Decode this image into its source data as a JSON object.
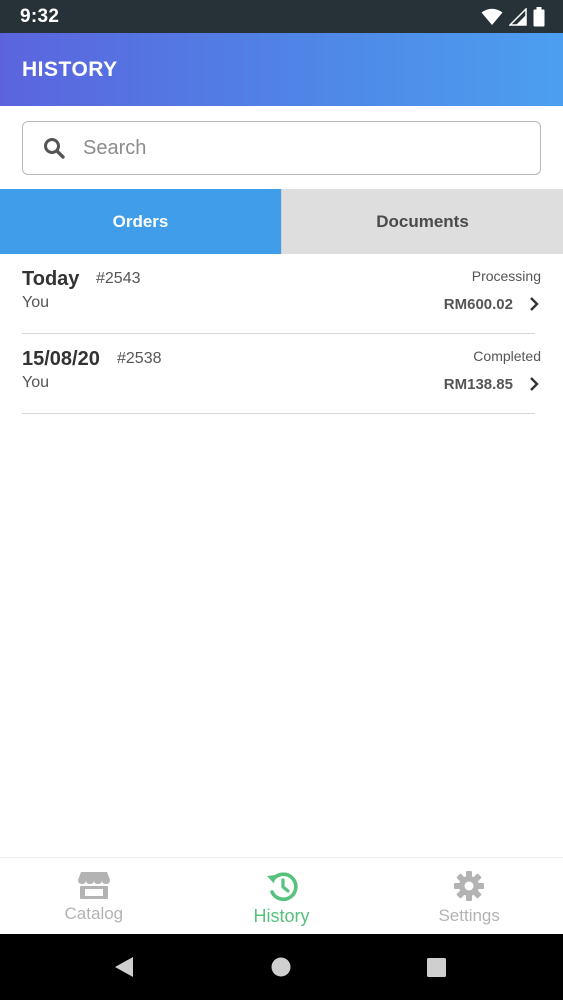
{
  "status_bar": {
    "time": "9:32"
  },
  "header": {
    "title": "HISTORY"
  },
  "search": {
    "placeholder": "Search",
    "value": ""
  },
  "tabs": [
    {
      "label": "Orders",
      "active": true
    },
    {
      "label": "Documents",
      "active": false
    }
  ],
  "orders": [
    {
      "date": "Today",
      "number": "#2543",
      "user": "You",
      "status": "Processing",
      "amount": "RM600.02"
    },
    {
      "date": "15/08/20",
      "number": "#2538",
      "user": "You",
      "status": "Completed",
      "amount": "RM138.85"
    }
  ],
  "bottom_nav": [
    {
      "label": "Catalog",
      "icon": "store-icon",
      "active": false
    },
    {
      "label": "History",
      "icon": "history-icon",
      "active": true
    },
    {
      "label": "Settings",
      "icon": "gear-icon",
      "active": false
    }
  ],
  "colors": {
    "accent": "#3f9de9",
    "active_nav": "#56c27d",
    "inactive_nav": "#b3b3b3",
    "status_bar": "#263238"
  }
}
